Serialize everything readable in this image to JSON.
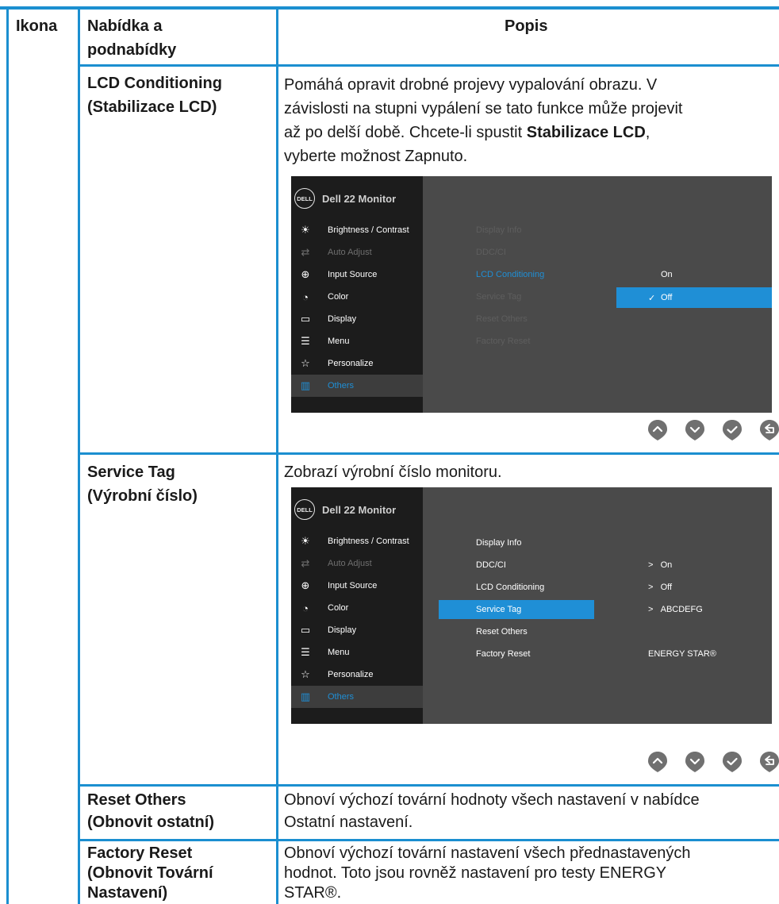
{
  "header": {
    "col_icon": "Ikona",
    "col_menu_line1": "Nabídka a",
    "col_menu_line2": "podnabídky",
    "col_desc": "Popis"
  },
  "rows": {
    "lcd": {
      "name_line1": "LCD Conditioning",
      "name_line2": "(Stabilizace LCD)",
      "desc_line1": "Pomáhá opravit drobné projevy vypalování obrazu. V",
      "desc_line2": "závislosti na stupni vypálení se tato funkce může projevit",
      "desc_line3_a": "až po delší době. Chcete-li spustit ",
      "desc_line3_b": "Stabilizace LCD",
      "desc_line3_c": ",",
      "desc_line4": "vyberte možnost Zapnuto."
    },
    "service": {
      "name_line1": "Service Tag",
      "name_line2": "(Výrobní číslo)",
      "desc_line1": "Zobrazí výrobní číslo monitoru."
    },
    "reset_others": {
      "name_line1": "Reset Others",
      "name_line2": "(Obnovit ostatní)",
      "desc_line1": "Obnoví výchozí tovární hodnoty všech nastavení v nabídce",
      "desc_line2": "Ostatní nastavení."
    },
    "factory_reset": {
      "name_line1": "Factory Reset",
      "name_line2": "(Obnovit Tovární",
      "name_line3": "Nastavení)",
      "desc_line1": "Obnoví výchozí tovární nastavení všech přednastavených",
      "desc_line2": "hodnot. Toto jsou rovněž nastavení pro testy ENERGY",
      "desc_line3": "STAR®."
    }
  },
  "osd": {
    "logo": "DELL",
    "title": "Dell 22 Monitor",
    "menu": [
      "Brightness / Contrast",
      "Auto Adjust",
      "Input Source",
      "Color",
      "Display",
      "Menu",
      "Personalize",
      "Others"
    ],
    "submenu": [
      "Display Info",
      "DDC/CI",
      "LCD Conditioning",
      "Service Tag",
      "Reset Others",
      "Factory Reset"
    ],
    "lcd_options": [
      "On",
      "Off"
    ],
    "service_values": {
      "ddc": "On",
      "lcd": "Off",
      "tag": "ABCDEFG",
      "arrow": ">",
      "energy": "ENERGY STAR®"
    }
  },
  "colors": {
    "table_rule": "#1b8fd0",
    "osd_highlight": "#1f8fd6",
    "osd_panel": "#4a4a4a",
    "osd_sidebar": "#1c1c1c",
    "buttons": "#707070"
  },
  "icons": {
    "menu": [
      "brightness-icon",
      "auto-adjust-icon",
      "input-source-icon",
      "color-icon",
      "display-icon",
      "menu-icon",
      "personalize-icon",
      "others-icon"
    ],
    "buttons": [
      "up-button-icon",
      "down-button-icon",
      "ok-button-icon",
      "back-button-icon"
    ]
  }
}
